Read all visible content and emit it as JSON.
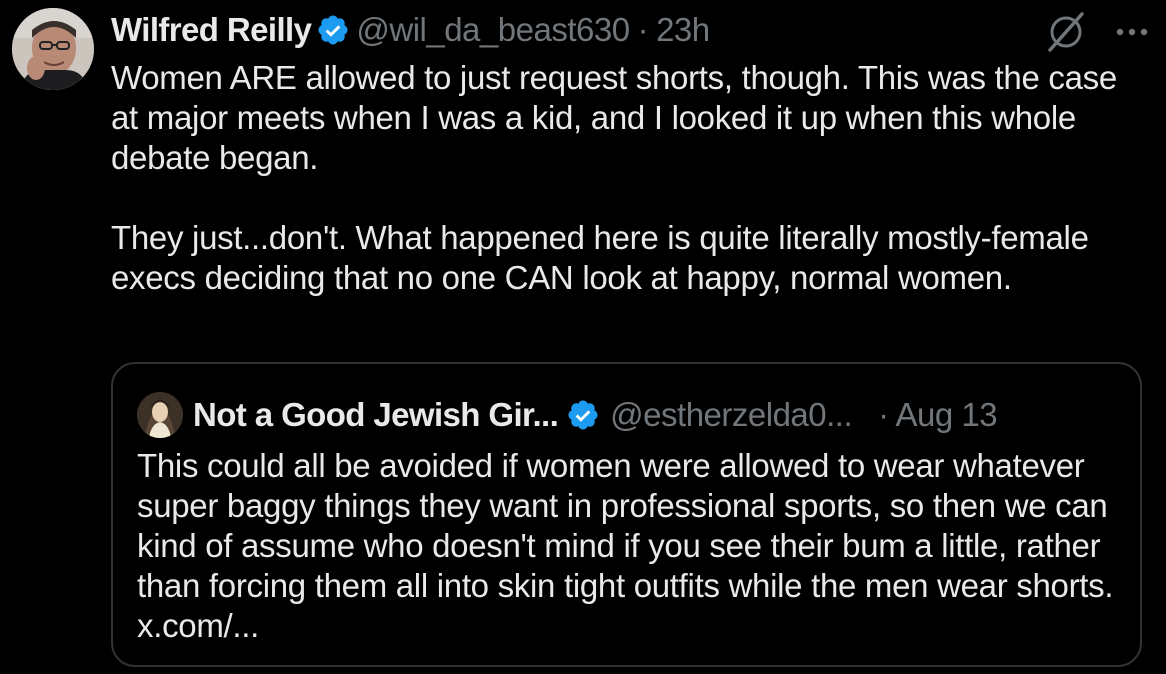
{
  "tweet": {
    "author_name": "Wilfred Reilly",
    "handle": "@wil_da_beast630",
    "separator": "·",
    "time": "23h",
    "text": "Women ARE allowed to just request shorts, though. This was the case at major meets when I was a kid, and I looked it up when this whole debate began.\n\nThey just...don't. What happened here is quite literally mostly-female execs deciding that no one CAN look at happy, normal women.",
    "more_label": "···"
  },
  "quoted_tweet": {
    "author_name": "Not a Good Jewish Gir...",
    "handle": "@estherzelda0...",
    "date": "· Aug 13",
    "text": "This could all be avoided if women were allowed to wear whatever super baggy things they want in professional sports, so then we can kind of assume who doesn't mind if you see their bum a little, rather than forcing them all into skin tight outfits while the men wear shorts. x.com/..."
  },
  "colors": {
    "background": "#000000",
    "text_primary": "#e7e9ea",
    "text_secondary": "#71767b",
    "verified_blue": "#1d9bf0",
    "border": "#2f3336"
  },
  "icons": {
    "verified": "verified-badge-icon",
    "grok": "grok-icon",
    "more": "more-options-icon"
  }
}
